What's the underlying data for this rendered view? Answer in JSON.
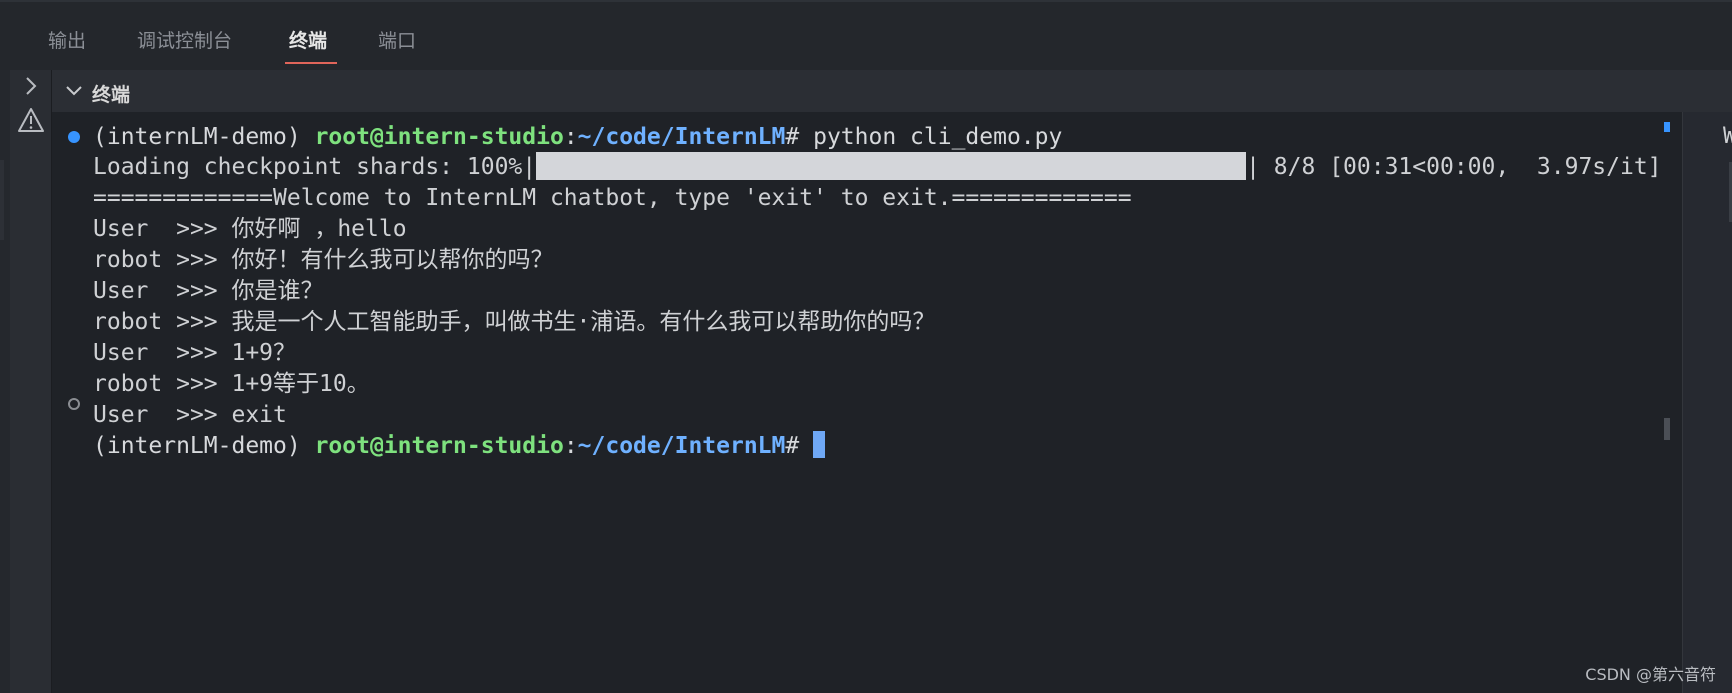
{
  "tabs": [
    {
      "label": "输出"
    },
    {
      "label": "调试控制台"
    },
    {
      "label": "终端",
      "active": true
    },
    {
      "label": "端口"
    }
  ],
  "section": {
    "title": "终端"
  },
  "terminal": {
    "command_line": {
      "env": "(internLM-demo) ",
      "user_host": "root@intern-studio",
      "colon": ":",
      "path": "~/code/InternLM",
      "prompt_symbol": "# ",
      "command": "python cli_demo.py"
    },
    "progress": {
      "label": "Loading checkpoint shards: 100%|",
      "percent": 100,
      "suffix": "| 8/8 [00:31<00:00,  3.97s/it]"
    },
    "banner": "=============Welcome to InternLM chatbot, type 'exit' to exit.=============",
    "chat": [
      {
        "speaker": "User  ",
        "prompt": ">>> ",
        "text": "你好啊 ，hello"
      },
      {
        "speaker": "robot ",
        "prompt": ">>> ",
        "text": "你好！有什么我可以帮你的吗？"
      },
      {
        "speaker": "User  ",
        "prompt": ">>> ",
        "text": "你是谁？"
      },
      {
        "speaker": "robot ",
        "prompt": ">>> ",
        "text": "我是一个人工智能助手，叫做书生·浦语。有什么我可以帮助你的吗？"
      },
      {
        "speaker": "User  ",
        "prompt": ">>> ",
        "text": "1+9？"
      },
      {
        "speaker": "robot ",
        "prompt": ">>> ",
        "text": "1+9等于10。"
      },
      {
        "speaker": "User  ",
        "prompt": ">>> ",
        "text": "exit"
      }
    ],
    "final_prompt": {
      "env": "(internLM-demo) ",
      "user_host": "root@intern-studio",
      "colon": ":",
      "path": "~/code/InternLM",
      "prompt_symbol": "# "
    }
  },
  "right_panel": {
    "glyph": "W"
  },
  "watermark": "CSDN @第六音符",
  "colors": {
    "accent_underline": "#e0655a",
    "prompt_green": "#7ee17e",
    "path_blue": "#6fb1ff",
    "status_dot": "#3794ff",
    "background": "#1f2227"
  }
}
